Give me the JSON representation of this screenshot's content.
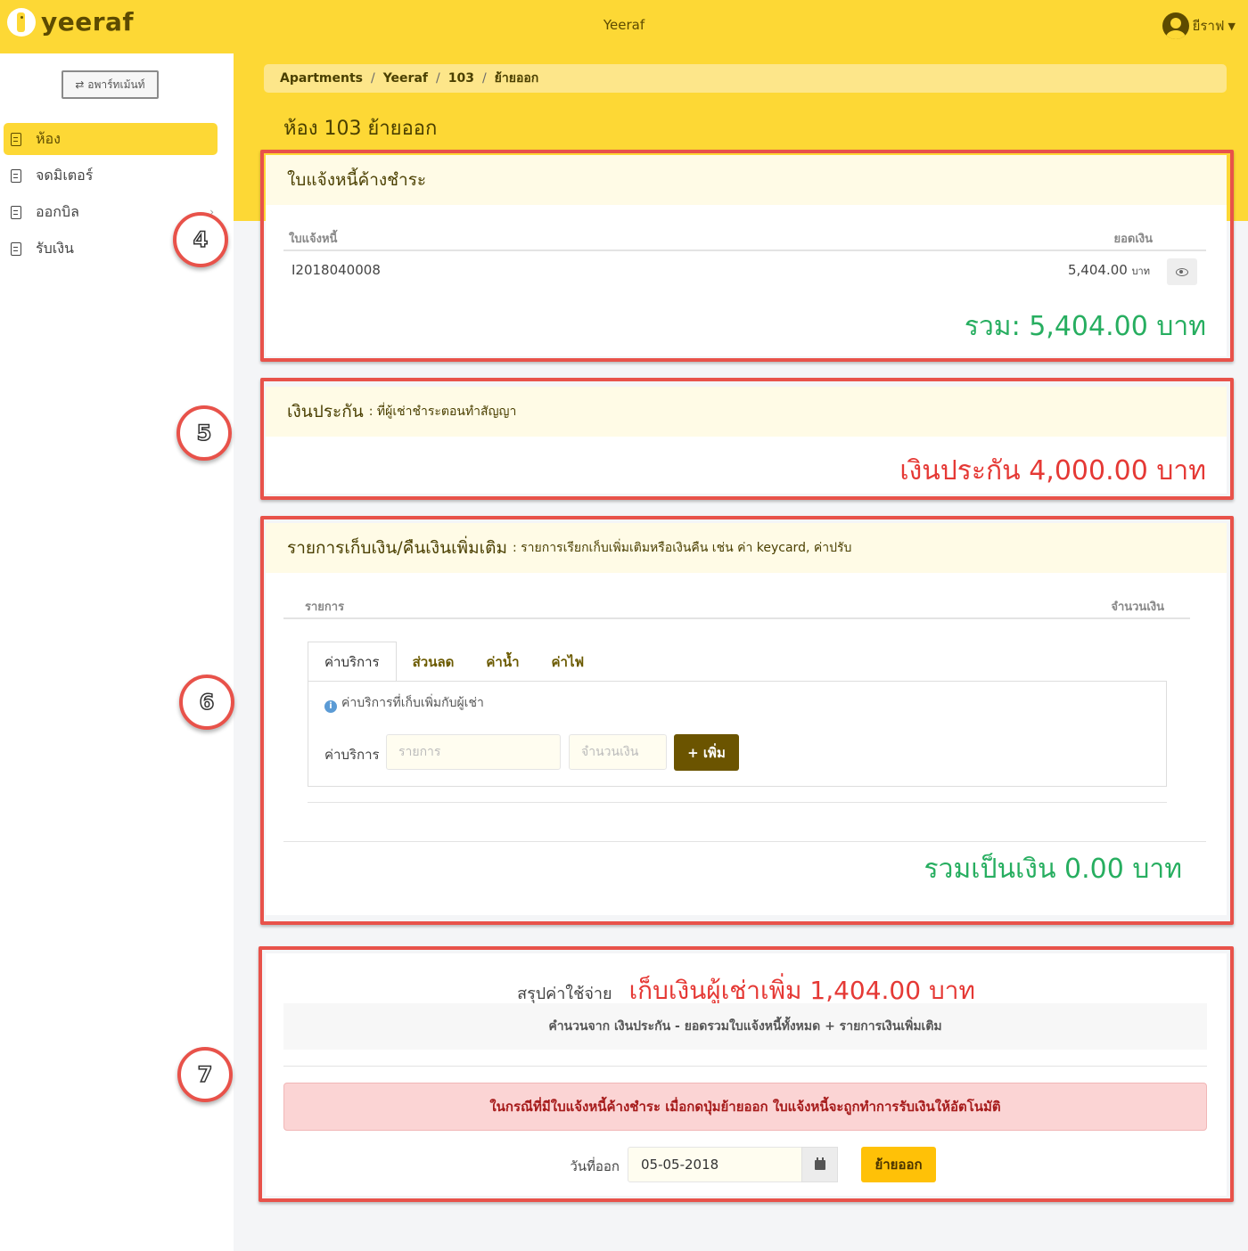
{
  "header": {
    "brand": "yeeraf",
    "title": "Yeeraf",
    "user_name": "ยีราฟ"
  },
  "sidebar": {
    "apartment_button": "⇄ อพาร์ทเม้นท์",
    "items": [
      {
        "label": "ห้อง",
        "active": true
      },
      {
        "label": "จดมิเตอร์",
        "active": false
      },
      {
        "label": "ออกบิล",
        "active": false
      },
      {
        "label": "รับเงิน",
        "active": false
      }
    ]
  },
  "breadcrumb": [
    "Apartments",
    "Yeeraf",
    "103",
    "ย้ายออก"
  ],
  "page_title": "ห้อง 103 ย้ายออก",
  "annotations": [
    "4",
    "5",
    "6",
    "7"
  ],
  "outstanding": {
    "header": "ใบแจ้งหนี้ค้างชำระ",
    "col_invoice": "ใบแจ้งหนี้",
    "col_amount": "ยอดเงิน",
    "rows": [
      {
        "invoice": "I2018040008",
        "amount": "5,404.00",
        "unit": "บาท"
      }
    ],
    "total": "รวม: 5,404.00 บาท"
  },
  "deposit": {
    "header": "เงินประกัน",
    "subheader": ": ที่ผู้เช่าชำระตอนทำสัญญา",
    "total": "เงินประกัน 4,000.00 บาท"
  },
  "extra": {
    "header": "รายการเก็บเงิน/คืนเงินเพิ่มเติม",
    "subheader": ": รายการเรียกเก็บเพิ่มเติมหรือเงินคืน เช่น ค่า keycard, ค่าปรับ",
    "col_item": "รายการ",
    "col_amount": "จำนวนเงิน",
    "tabs": [
      "ค่าบริการ",
      "ส่วนลด",
      "ค่าน้ำ",
      "ค่าไฟ"
    ],
    "info": "ค่าบริการที่เก็บเพิ่มกับผู้เช่า",
    "form_label": "ค่าบริการ",
    "item_placeholder": "รายการ",
    "amount_placeholder": "จำนวนเงิน",
    "add_button": "+ เพิ่ม",
    "total": "รวมเป็นเงิน 0.00 บาท"
  },
  "summary": {
    "label": "สรุปค่าใช้จ่าย",
    "amount_text": "เก็บเงินผู้เช่าเพิ่ม 1,404.00 บาท",
    "formula": "คำนวนจาก เงินประกัน - ยอดรวมใบแจ้งหนี้ทั้งหมด + รายการเงินเพิ่มเติม",
    "alert": "ในกรณีที่มีใบแจ้งหนี้ค้างชำระ เมื่อกดปุ่มย้ายออก ใบแจ้งหนี้จะถูกทำการรับเงินให้อัตโนมัติ",
    "date_label": "วันที่ออก",
    "date_value": "05-05-2018",
    "moveout_button": "ย้ายออก"
  },
  "colors": {
    "brand_yellow": "#fdd835",
    "highlight_red": "#e8524a",
    "total_green": "#27ae60",
    "total_red": "#e53935"
  }
}
